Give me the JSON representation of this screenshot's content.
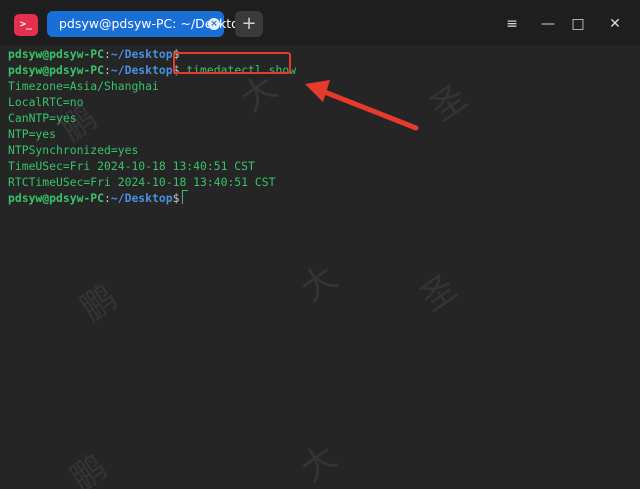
{
  "titlebar": {
    "app_icon_glyph": ">_",
    "tab_title": "pdsyw@pdsyw-PC: ~/Desktop",
    "tab_close_glyph": "×",
    "new_tab_glyph": "+",
    "menu_glyph": "≡",
    "minimize_glyph": "—",
    "maximize_glyph": "□",
    "close_glyph": "✕"
  },
  "terminal": {
    "prompt": {
      "user_host": "pdsyw@pdsyw-PC",
      "colon": ":",
      "path": "~/Desktop",
      "dollar": "$"
    },
    "command": "timedatectl show",
    "output": [
      "Timezone=Asia/Shanghai",
      "LocalRTC=no",
      "CanNTP=yes",
      "NTP=yes",
      "NTPSynchronized=yes",
      "TimeUSec=Fri 2024-10-18 13:40:51 CST",
      "RTCTimeUSec=Fri 2024-10-18 13:40:51 CST"
    ]
  },
  "watermark": {
    "chars": [
      "鹏",
      "大",
      "圣"
    ]
  },
  "colors": {
    "tab_active": "#1a6fd6",
    "terminal_bg": "#252525",
    "prompt_green": "#39c26a",
    "path_blue": "#4b8fe0",
    "annotation_red": "#e53a2c"
  }
}
